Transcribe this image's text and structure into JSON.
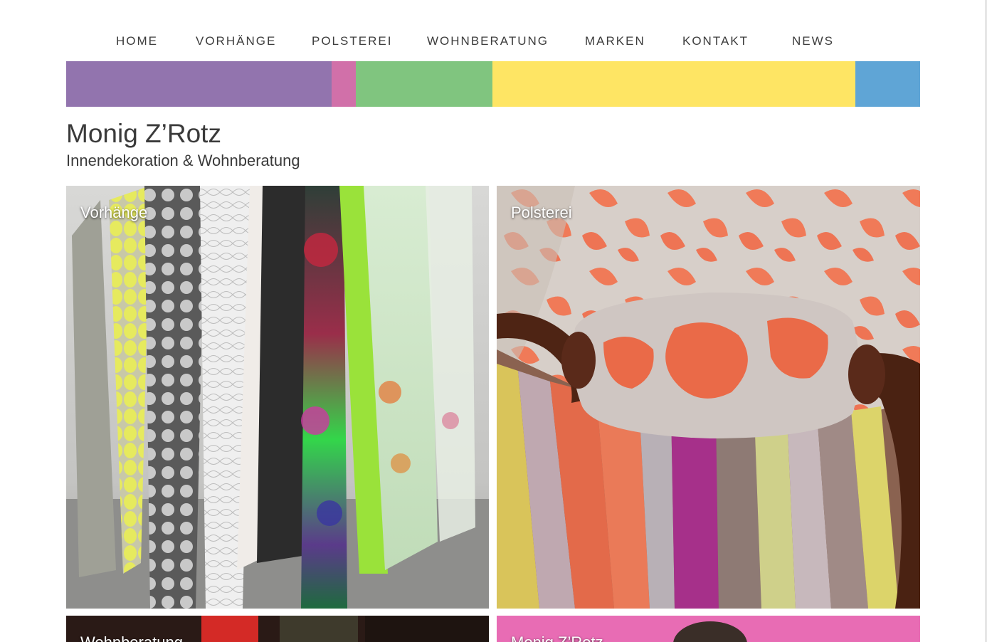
{
  "nav": {
    "items": [
      {
        "label": "HOME"
      },
      {
        "label": "VORHÄNGE"
      },
      {
        "label": "POLSTEREI"
      },
      {
        "label": "WOHNBERATUNG"
      },
      {
        "label": "MARKEN"
      },
      {
        "label": "KONTAKT"
      },
      {
        "label": "NEWS"
      }
    ]
  },
  "color_band": {
    "colors": [
      "#9274ae",
      "#d170a9",
      "#80c57f",
      "#fee564",
      "#5fa5d6"
    ]
  },
  "site": {
    "title": "Monig Z’Rotz",
    "subtitle": "Innendekoration & Wohnberatung"
  },
  "tiles": [
    {
      "label": "Vorhänge"
    },
    {
      "label": "Polsterei"
    },
    {
      "label": "Wohnberatung"
    },
    {
      "label": "Monig Z’Rotz"
    }
  ]
}
